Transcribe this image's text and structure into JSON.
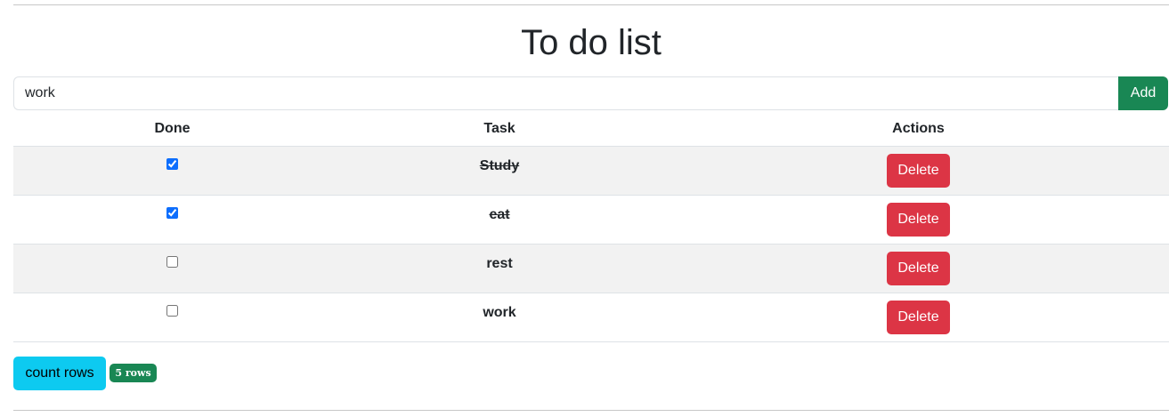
{
  "header": {
    "title": "To do list"
  },
  "new_task": {
    "value": "work",
    "add_label": "Add"
  },
  "table": {
    "columns": [
      "Done",
      "Task",
      "Actions"
    ],
    "rows": [
      {
        "done": true,
        "task": "Study",
        "action_label": "Delete"
      },
      {
        "done": true,
        "task": "eat",
        "action_label": "Delete"
      },
      {
        "done": false,
        "task": "rest",
        "action_label": "Delete"
      },
      {
        "done": false,
        "task": "work",
        "action_label": "Delete"
      }
    ]
  },
  "footer": {
    "count_label": "count rows",
    "count_badge": "5 rows"
  },
  "colors": {
    "add": "#198754",
    "delete": "#dc3545",
    "count": "#0dcaf0",
    "badge": "#198754",
    "stripe": "#f2f2f2"
  }
}
